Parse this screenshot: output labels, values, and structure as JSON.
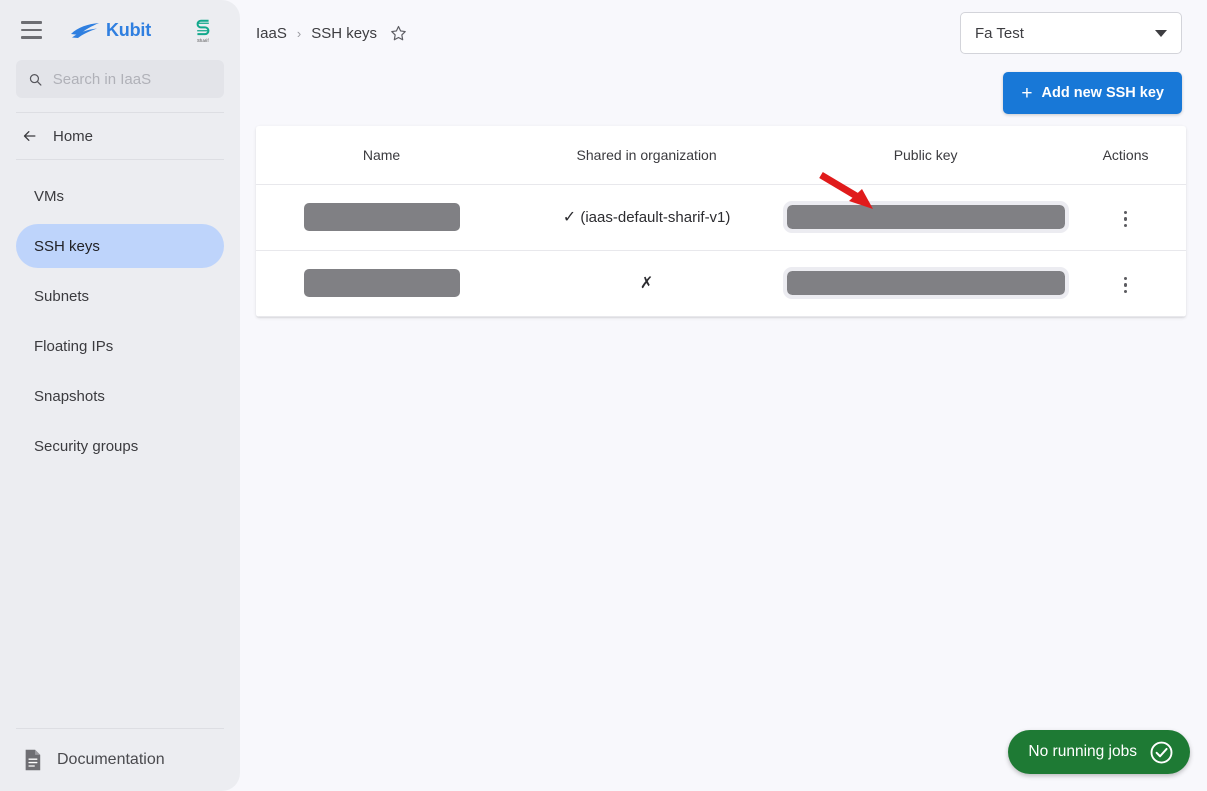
{
  "sidebar": {
    "menu_icon": "hamburger-icon",
    "brand": {
      "name": "Kubit",
      "mark": "wave-logo-icon"
    },
    "partner": {
      "mark": "s-logo-icon",
      "sub_text": "Sharif"
    },
    "search": {
      "placeholder": "Search in IaaS",
      "value": "",
      "icon": "search-icon"
    },
    "home": {
      "label": "Home",
      "icon": "arrow-left-icon"
    },
    "items": [
      {
        "label": "VMs",
        "active": false
      },
      {
        "label": "SSH keys",
        "active": true
      },
      {
        "label": "Subnets",
        "active": false
      },
      {
        "label": "Floating IPs",
        "active": false
      },
      {
        "label": "Snapshots",
        "active": false
      },
      {
        "label": "Security groups",
        "active": false
      }
    ],
    "footer": {
      "label": "Documentation",
      "icon": "document-icon"
    }
  },
  "header": {
    "breadcrumb": [
      "IaaS",
      "SSH keys"
    ],
    "separator": "›",
    "favorite_icon": "star-outline-icon",
    "workspace_select": {
      "value": "Fa Test",
      "caret": "chevron-down-icon"
    }
  },
  "toolbar": {
    "add_key_label": "Add new SSH key",
    "add_key_icon": "plus-icon"
  },
  "table": {
    "columns": [
      "Name",
      "Shared in organization",
      "Public key",
      "Actions"
    ],
    "rows": [
      {
        "name": "",
        "name_redacted": true,
        "shared_mark": "✓",
        "shared_text": "(iaas-default-sharif-v1)",
        "shared_is_yes": true,
        "public_key": "",
        "public_key_redacted": true,
        "actions_icon": "kebab-menu-icon"
      },
      {
        "name": "",
        "name_redacted": true,
        "shared_mark": "✗",
        "shared_text": "",
        "shared_is_yes": false,
        "public_key": "",
        "public_key_redacted": true,
        "actions_icon": "kebab-menu-icon"
      }
    ]
  },
  "annotation": {
    "arrow_color": "#e01b1b",
    "points_to": "Public key column cell"
  },
  "status": {
    "label": "No running jobs",
    "icon": "check-circle-icon",
    "color": "#1e7a34"
  },
  "colors": {
    "accent": "#1878d7",
    "sidebar_bg": "#ecedf1",
    "active_item_bg": "#bed4fb",
    "page_bg": "#f8f8fc",
    "redaction": "#808084"
  }
}
